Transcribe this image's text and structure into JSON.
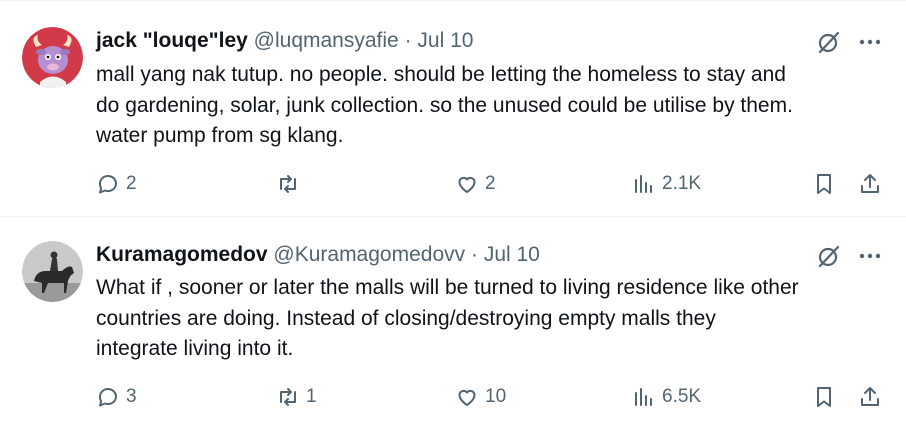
{
  "tweets": [
    {
      "name": "jack \"louqe\"ley",
      "handle": "@luqmansyafie",
      "separator": "·",
      "date": "Jul 10",
      "text": "mall yang nak tutup. no people. should be letting the homeless to stay and\ndo gardening, solar, junk collection. so the unused could be utilise by them.\nwater pump from sg klang.",
      "replies": "2",
      "retweets": "",
      "likes": "2",
      "views": "2.1K"
    },
    {
      "name": "Kuramagomedov",
      "handle": "@Kuramagomedovv",
      "separator": "·",
      "date": "Jul 10",
      "text": "What if , sooner or later the malls will be turned to living residence like other\ncountries are doing. Instead of closing/destroying empty malls they\nintegrate living into it.",
      "replies": "3",
      "retweets": "1",
      "likes": "10",
      "views": "6.5K"
    }
  ],
  "colors": {
    "text_primary": "#0f1419",
    "text_secondary": "#536471",
    "divider": "#eff3f4",
    "avatar1_bg": "#d23a4a"
  },
  "icons": [
    "reply-icon",
    "retweet-icon",
    "like-icon",
    "views-icon",
    "bookmark-icon",
    "share-icon",
    "grok-icon",
    "more-icon"
  ]
}
